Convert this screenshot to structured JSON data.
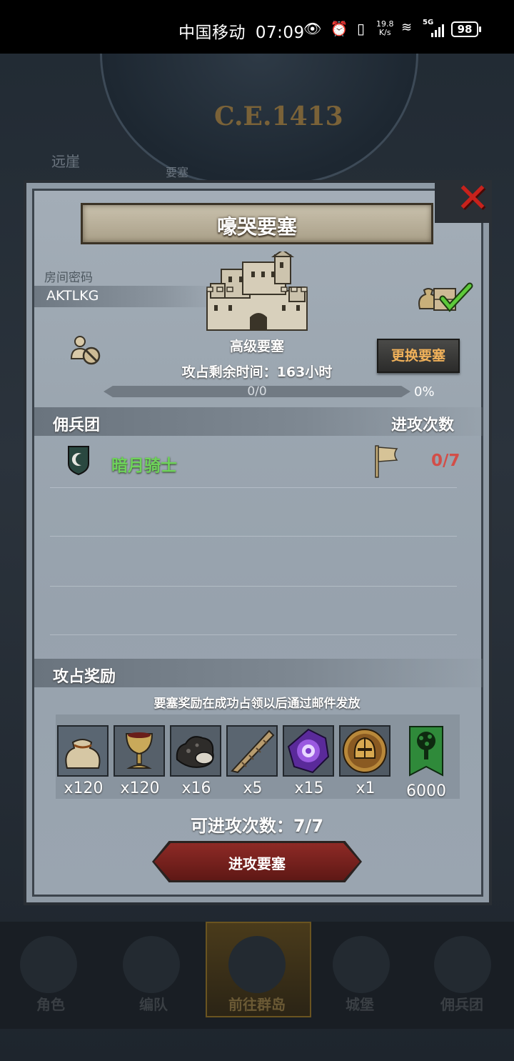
{
  "status_bar": {
    "carrier": "中国移动",
    "time": "07:09",
    "net_speed_value": "19.8",
    "net_speed_unit": "K/s",
    "network": "5G",
    "battery": "98"
  },
  "background": {
    "year": "C.E.1413",
    "label_left": "远崖",
    "label_center": "要塞"
  },
  "bottom_nav": {
    "items": [
      {
        "label": "角色"
      },
      {
        "label": "编队"
      },
      {
        "label": "前往群岛"
      },
      {
        "label": "城堡"
      },
      {
        "label": "佣兵团"
      }
    ],
    "active_index": 2
  },
  "dialog": {
    "title": "嚎哭要塞",
    "close_icon": "close-icon",
    "room": {
      "label": "房间密码",
      "code": "AKTLKG"
    },
    "fortress": {
      "name": "高级要塞",
      "time_remaining": "攻占剩余时间：163小时",
      "progress_text": "0/0",
      "progress_percent": "0%",
      "progress_value": 0
    },
    "change_button": "更换要塞",
    "mercenaries": {
      "header_left": "佣兵团",
      "header_right": "进攻次数",
      "rows": [
        {
          "name": "暗月骑士",
          "attacks": "0/7"
        }
      ]
    },
    "rewards": {
      "header": "攻占奖励",
      "note": "要塞奖励在成功占领以后通过邮件发放",
      "items": [
        {
          "icon": "sack-icon",
          "qty": "x120"
        },
        {
          "icon": "goblet-icon",
          "qty": "x120"
        },
        {
          "icon": "ore-icon",
          "qty": "x16"
        },
        {
          "icon": "horn-icon",
          "qty": "x5"
        },
        {
          "icon": "purple-gem-icon",
          "qty": "x15"
        },
        {
          "icon": "helmet-medal-icon",
          "qty": "x1"
        },
        {
          "icon": "tree-banner-icon",
          "qty": "6000"
        }
      ]
    },
    "attacks_available": "可进攻次数：7/7",
    "attack_button": "进攻要塞"
  }
}
